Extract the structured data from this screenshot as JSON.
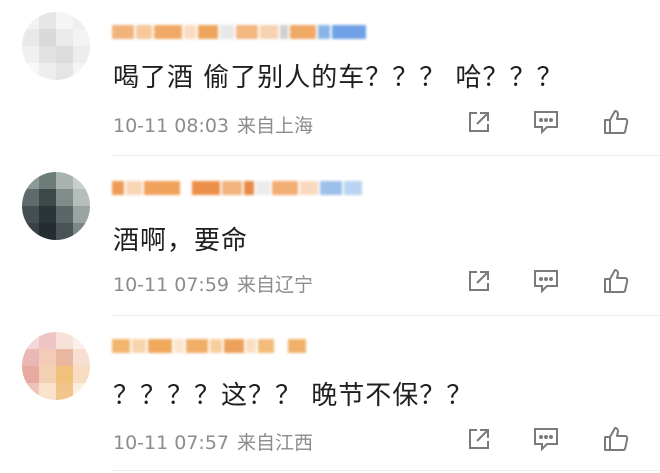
{
  "comments": [
    {
      "text": "喝了酒 偷了别人的车？？？ 哈？？？",
      "time": "10-11 08:03",
      "location": "来自上海",
      "avatar_icon": "blurred-avatar-icon"
    },
    {
      "text": "酒啊，要命",
      "time": "10-11 07:59",
      "location": "来自辽宁",
      "avatar_icon": "blurred-avatar-icon"
    },
    {
      "text": "？？？？这？？ 晚节不保？？",
      "time": "10-11 07:57",
      "location": "来自江西",
      "avatar_icon": "blurred-avatar-icon"
    }
  ],
  "actions": {
    "share_icon": "share-icon",
    "comment_icon": "comment-icon",
    "like_icon": "like-icon"
  },
  "colors": {
    "text": "#1f1f1f",
    "meta": "#8c8c8c",
    "icon": "#7a7a7a",
    "username_accent": "#f3a14a"
  }
}
